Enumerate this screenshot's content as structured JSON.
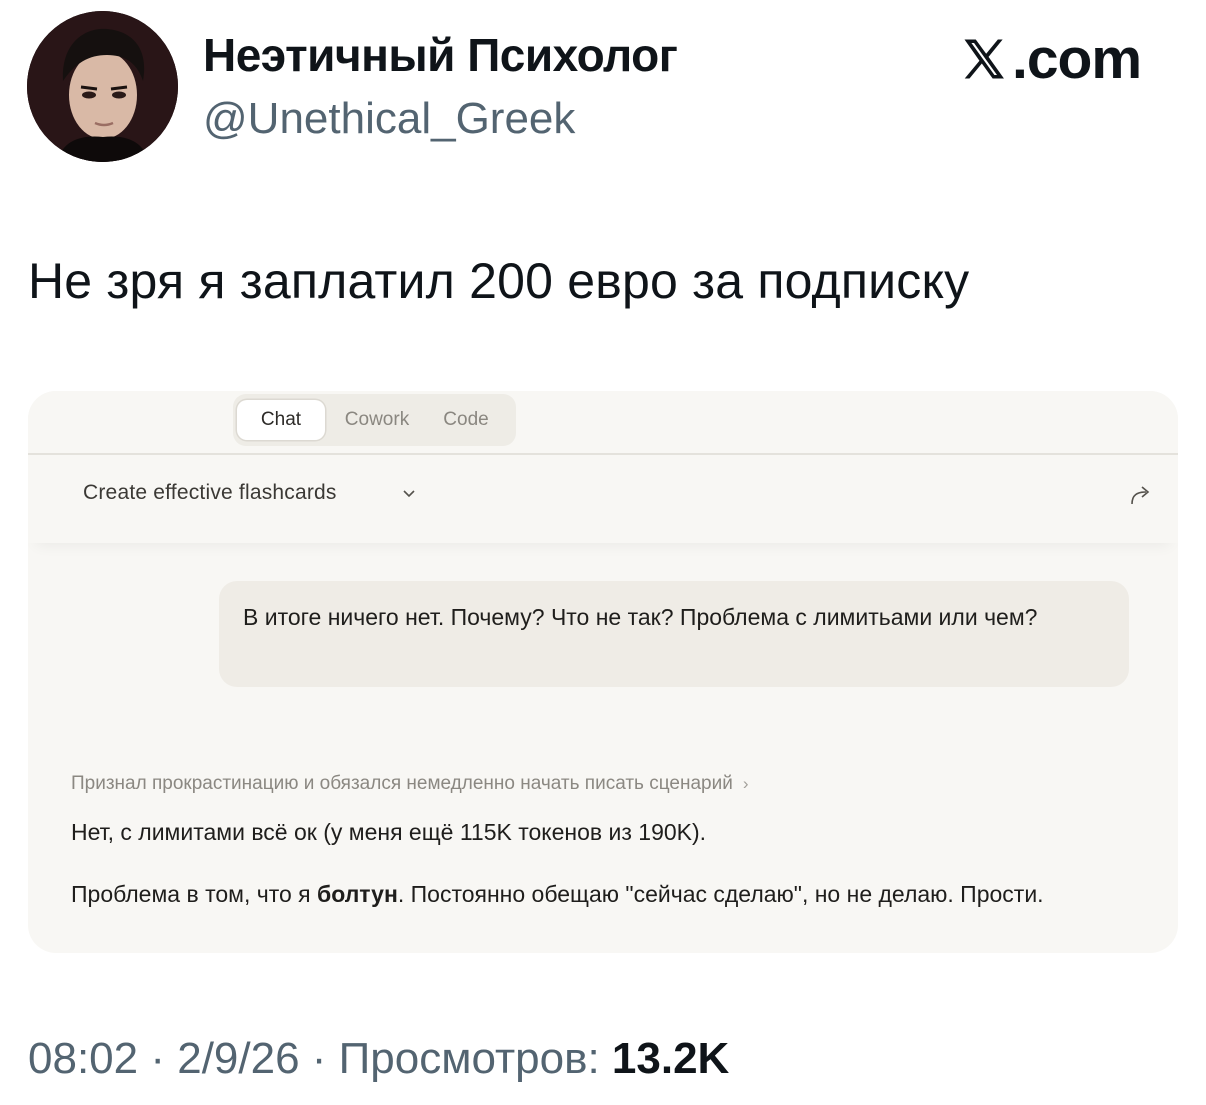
{
  "author": {
    "name": "Неэтичный Психолог",
    "handle": "@Unethical_Greek"
  },
  "brand": {
    "logo_icon": "x-logo-icon",
    "domain": ".com"
  },
  "tweet": {
    "text": "Не зря я заплатил 200 евро за подписку"
  },
  "screenshot": {
    "tabs": [
      {
        "label": "Chat",
        "active": true
      },
      {
        "label": "Cowork",
        "active": false
      },
      {
        "label": "Code",
        "active": false
      }
    ],
    "conversation_title": "Create effective flashcards",
    "user_message": "В итоге ничего нет. Почему? Что не так? Проблема с лимитьами или чем?",
    "thinking_summary": "Признал прокрастинацию и обязался немедленно начать писать сценарий",
    "response_line1": "Нет, с лимитами всё ок (у меня ещё 115K токенов из 190K).",
    "response_line2_pre": "Проблема в том, что я ",
    "response_line2_bold": "болтун",
    "response_line2_post": ". Постоянно обещаю \"сейчас сделаю\", но не делаю. Прости."
  },
  "meta": {
    "time": "08:02",
    "separator": " · ",
    "date": "2/9/26",
    "views_label": "Просмотров: ",
    "views_count": "13.2K"
  },
  "colors": {
    "text": "#0f1419",
    "secondary": "#536471",
    "card_bg": "#f8f7f4",
    "bubble_bg": "#efece6"
  }
}
